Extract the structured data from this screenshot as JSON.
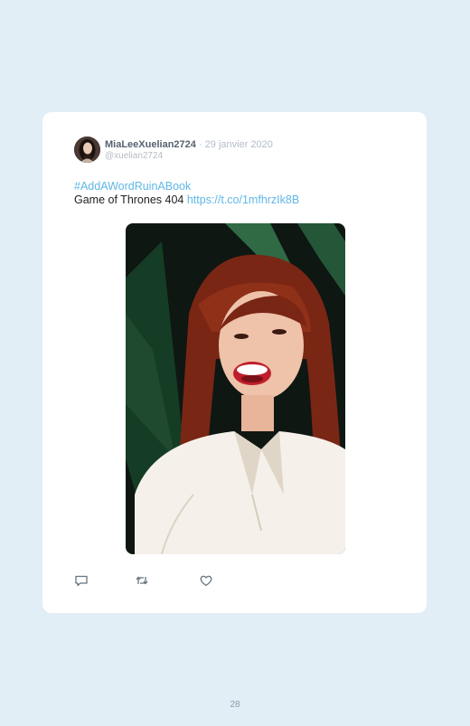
{
  "tweet": {
    "display_name": "MiaLeeXuelian2724",
    "separator": " · ",
    "date": "29 janvier 2020",
    "handle": "@xuelian2724",
    "hashtag": "#AddAWordRuinABook",
    "body_text": "Game of Thrones 404 ",
    "link": "https://t.co/1mfhrzIk8B"
  },
  "actions": {
    "reply_icon": "reply-icon",
    "retweet_icon": "retweet-icon",
    "like_icon": "heart-icon"
  },
  "colors": {
    "background": "#e2eef6",
    "card": "#ffffff",
    "link": "#5fb7e5",
    "name": "#556270",
    "muted": "#b4bcc4"
  },
  "page_number": "28"
}
